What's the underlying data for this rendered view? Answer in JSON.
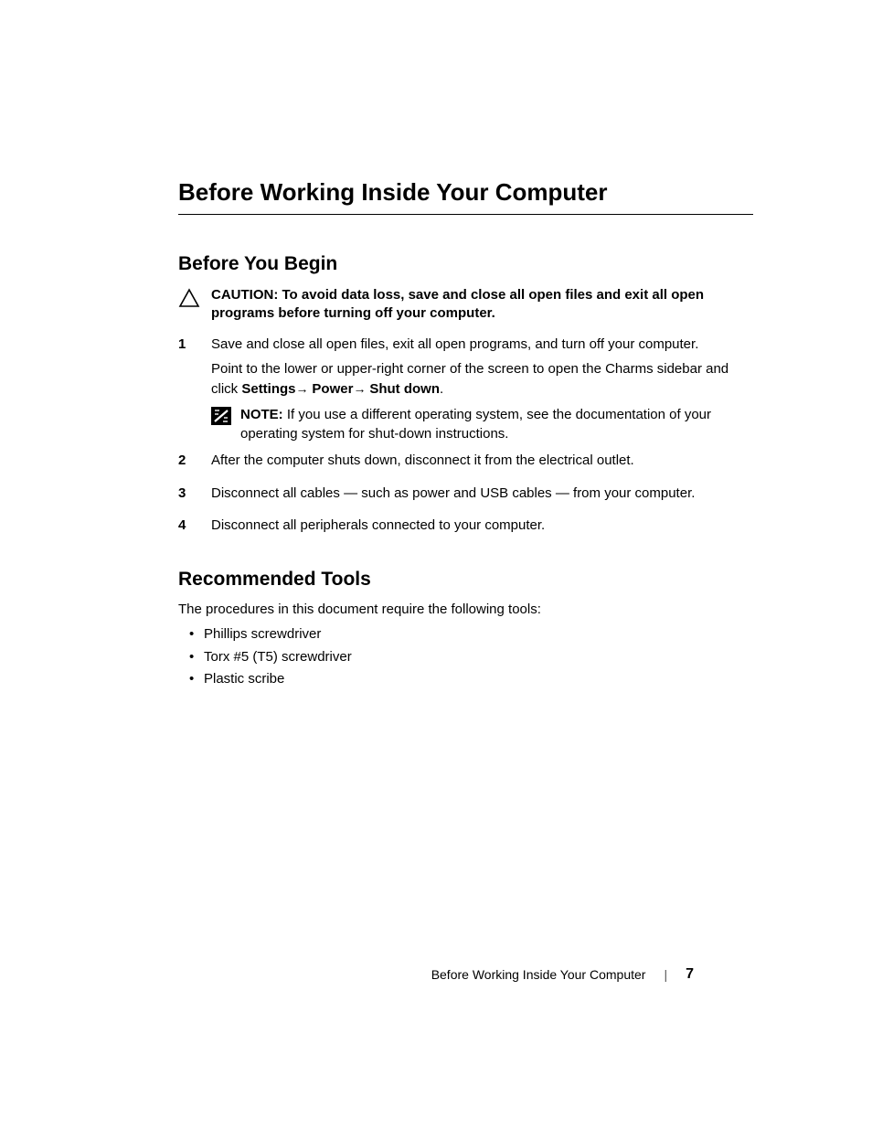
{
  "title": "Before Working Inside Your Computer",
  "section1": {
    "heading": "Before You Begin",
    "caution": {
      "label": "CAUTION:",
      "text": "To avoid data loss, save and close all open files and exit all open programs before turning off your computer."
    },
    "steps": [
      {
        "paras": [
          "Save and close all open files, exit all open programs, and turn off your computer."
        ],
        "settings": {
          "prefix": "Point to the lower or upper-right corner of the screen to open the Charms sidebar and click ",
          "parts": [
            "Settings",
            "Power",
            "Shut down"
          ],
          "suffix": "."
        },
        "note": {
          "label": "NOTE:",
          "text": "If you use a different operating system, see the documentation of your operating system for shut-down instructions."
        }
      },
      {
        "paras": [
          "After the computer shuts down, disconnect it from the electrical outlet."
        ]
      },
      {
        "paras": [
          "Disconnect all cables — such as power and USB cables — from your computer."
        ]
      },
      {
        "paras": [
          "Disconnect all peripherals connected to your computer."
        ]
      }
    ]
  },
  "section2": {
    "heading": "Recommended Tools",
    "intro": "The procedures in this document require the following tools:",
    "items": [
      "Phillips screwdriver",
      "Torx #5 (T5) screwdriver",
      "Plastic scribe"
    ]
  },
  "footer": {
    "text": "Before Working Inside Your Computer",
    "page": "7"
  }
}
